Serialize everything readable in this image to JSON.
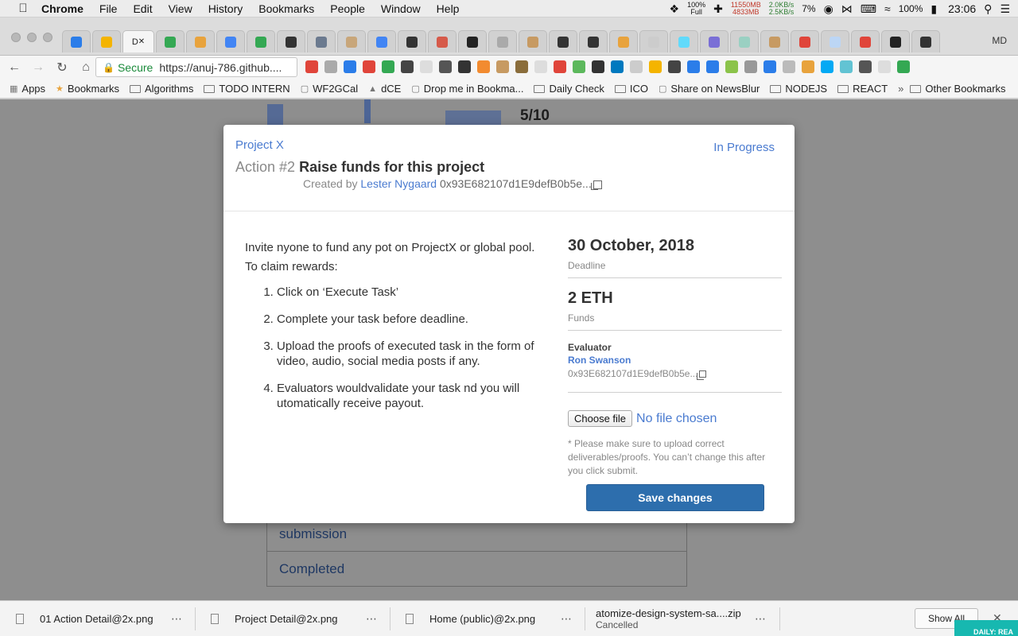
{
  "menubar": {
    "app": "Chrome",
    "menus": [
      "File",
      "Edit",
      "View",
      "History",
      "Bookmarks",
      "People",
      "Window",
      "Help"
    ],
    "battery_top": "100%",
    "battery_bottom": "Full",
    "mem_top": "11550MB",
    "mem_bottom": "4833MB",
    "net_up": "2.0KB/s",
    "net_down": "2.5KB/s",
    "cpu": "7%",
    "battery_pct": "100%",
    "time": "23:06"
  },
  "browser": {
    "profile": "MD",
    "active_tab_label": "D",
    "secure_label": "Secure",
    "url": "https://anuj-786.github....",
    "tab_colors": [
      "#2b7de9",
      "#f4b400",
      "#f5f5f5",
      "#34a853",
      "#e8a33d",
      "#4285f4",
      "#34a853",
      "#333333",
      "#6b7a8f",
      "#c8a67a",
      "#4285f4",
      "#333333",
      "#d65a4a",
      "#222222",
      "#aaaaaa",
      "#c79a62",
      "#333333",
      "#333333",
      "#e8a33d",
      "#cccccc",
      "#61dafb",
      "#7a6fd6",
      "#9ad0c2",
      "#c79a62",
      "#e0453a",
      "#bcd6f5",
      "#e0453a",
      "#222222",
      "#333333"
    ],
    "extension_colors": [
      "#e0453a",
      "#aaaaaa",
      "#2b7de9",
      "#e0453a",
      "#34a853",
      "#444444",
      "#dddddd",
      "#555555",
      "#333333",
      "#f28b30",
      "#c79a62",
      "#8a6d3b",
      "#dddddd",
      "#e0453a",
      "#5cb85c",
      "#333333",
      "#0079bf",
      "#cccccc",
      "#f4b400",
      "#444444",
      "#2b7de9",
      "#2b7de9",
      "#8bc34a",
      "#999999",
      "#2b7de9",
      "#bbbbbb",
      "#e8a33d",
      "#03a9f4",
      "#62c3d3",
      "#555555",
      "#dddddd",
      "#34a853"
    ]
  },
  "bookmarks": [
    "Apps",
    "Bookmarks",
    "Algorithms",
    "TODO INTERN",
    "WF2GCal",
    "dCE",
    "Drop me in Bookma...",
    "Daily Check",
    "ICO",
    "Share on NewsBlur",
    "NODEJS",
    "REACT",
    "Other Bookmarks"
  ],
  "background": {
    "score": "5/10",
    "list": [
      "submission",
      "Completed"
    ]
  },
  "modal": {
    "project": "Project X",
    "status": "In Progress",
    "action_num": "Action #2",
    "action_name": "Raise funds for this project",
    "created_prefix": "Created by",
    "author": "Lester Nygaard",
    "author_address": "0x93E682107d1E9defB0b5e...",
    "intro": "Invite nyone to fund any pot on ProjectX or global pool.",
    "claim": "To claim rewards:",
    "steps": [
      "Click on ‘Execute Task’",
      "Complete your task before deadline.",
      "Upload the proofs of executed task in the form of video, audio, social media posts if any.",
      "Evaluators wouldvalidate your task nd you will utomatically receive payout."
    ],
    "deadline": "30 October, 2018",
    "deadline_label": "Deadline",
    "funds": "2 ETH",
    "funds_label": "Funds",
    "evaluator_label": "Evaluator",
    "evaluator_name": "Ron Swanson",
    "evaluator_address": "0x93E682107d1E9defB0b5e...",
    "choose_file": "Choose file",
    "no_file": "No file chosen",
    "note": "* Please make sure to upload correct deliverables/proofs. You can’t change this after you click submit.",
    "save": "Save changes"
  },
  "downloads": {
    "items": [
      {
        "name": "01 Action Detail@2x.png"
      },
      {
        "name": "Project Detail@2x.png"
      },
      {
        "name": "Home (public)@2x.png"
      },
      {
        "name": "atomize-design-system-sa....zip",
        "status": "Cancelled"
      }
    ],
    "show_all": "Show All",
    "close": "✕"
  },
  "corner_banner": "DAILY: REA"
}
